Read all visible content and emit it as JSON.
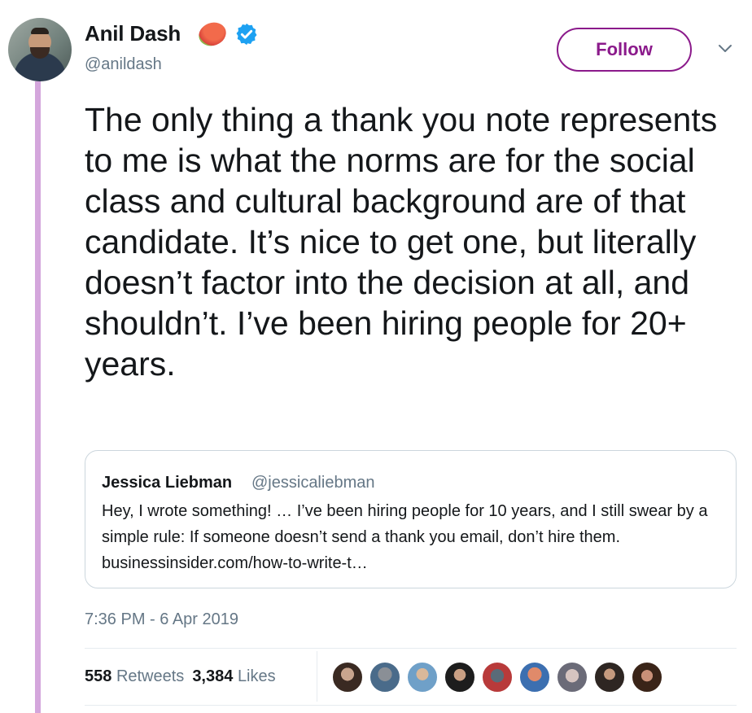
{
  "tweet": {
    "author_name": "Anil Dash",
    "handle": "@anildash",
    "follow_label": "Follow",
    "text": "The only thing a thank you note represents to me is what the norms are for the social class and cultural background are of that candidate. It’s nice to get one, but literally doesn’t factor into the decision at all, and shouldn’t. I’ve been hiring people for 20+ years.",
    "timestamp": "7:36 PM - 6 Apr 2019"
  },
  "quote": {
    "name": "Jessica Liebman",
    "handle": "@jessicaliebman",
    "text": "Hey, I wrote something! … I’ve been hiring people for 10 years, and I still swear by a simple rule: If someone doesn’t send a thank you email, don’t hire them. businessinsider.com/how-to-write-t…"
  },
  "stats": {
    "retweets_count": "558",
    "retweets_label": "Retweets",
    "likes_count": "3,384",
    "likes_label": "Likes"
  },
  "icons": {
    "verified": "verified-badge-icon",
    "emoji": "peach-emoji-icon",
    "caret": "chevron-down-icon"
  },
  "colors": {
    "follow_accent": "#8b1a8b",
    "thread_line": "#d4a6dc",
    "verified_blue": "#1da1f2",
    "secondary_text": "#657786"
  }
}
